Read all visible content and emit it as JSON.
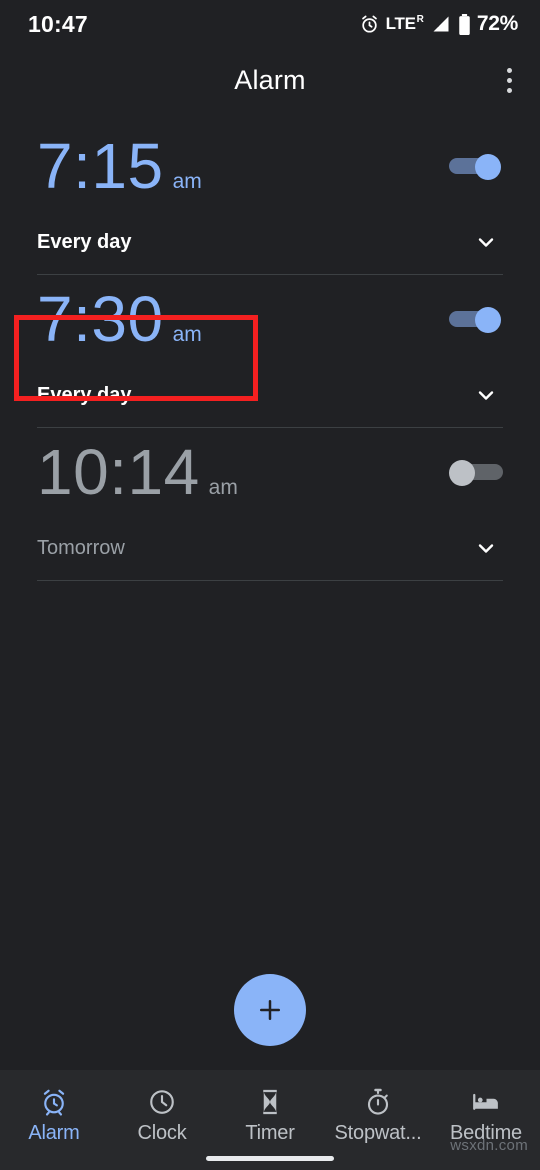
{
  "status_bar": {
    "time": "10:47",
    "network": "LTE",
    "roaming": "R",
    "battery": "72%",
    "icons": [
      "alarm-icon",
      "signal-icon",
      "battery-icon"
    ]
  },
  "app_bar": {
    "title": "Alarm",
    "overflow_label": "more-options"
  },
  "alarms": [
    {
      "time": "7:15",
      "meridiem": "am",
      "schedule": "Every day",
      "enabled": true,
      "highlighted": false
    },
    {
      "time": "7:30",
      "meridiem": "am",
      "schedule": "Every day",
      "enabled": true,
      "highlighted": true
    },
    {
      "time": "10:14",
      "meridiem": "am",
      "schedule": "Tomorrow",
      "enabled": false,
      "highlighted": false
    }
  ],
  "fab": {
    "label": "add-alarm",
    "glyph": "+",
    "color": "#8ab4f8"
  },
  "bottom_nav": {
    "items": [
      {
        "label": "Alarm",
        "icon": "alarm-clock-icon",
        "active": true
      },
      {
        "label": "Clock",
        "icon": "clock-icon",
        "active": false
      },
      {
        "label": "Timer",
        "icon": "hourglass-icon",
        "active": false
      },
      {
        "label": "Stopwat...",
        "icon": "stopwatch-icon",
        "active": false
      },
      {
        "label": "Bedtime",
        "icon": "bed-icon",
        "active": false
      }
    ]
  },
  "annotation": {
    "color": "#f42020",
    "target": "alarm-2-time"
  },
  "watermark": "wsxdn.com",
  "theme": {
    "background": "#202124",
    "nav_background": "#28292c",
    "accent": "#8ab4f8",
    "disabled": "#9aa0a6",
    "divider": "#3c4043"
  }
}
